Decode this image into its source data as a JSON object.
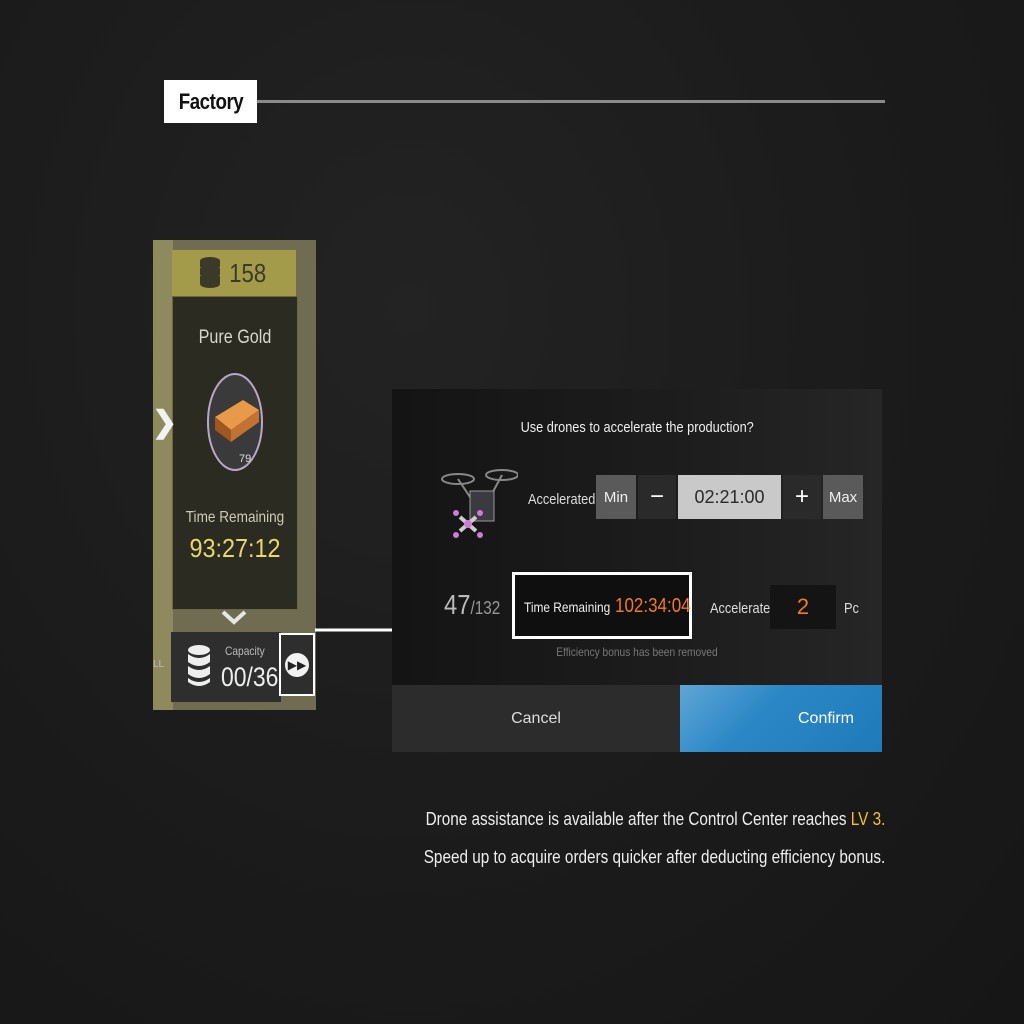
{
  "header": {
    "title": "Factory"
  },
  "factory_card": {
    "stock": "158",
    "item_name": "Pure Gold",
    "item_count": "79",
    "time_remaining_label": "Time Remaining",
    "time_remaining_value": "93:27:12",
    "capacity_label": "Capacity",
    "capacity_value": "00/36",
    "edge_label": "LL"
  },
  "dialog": {
    "question": "Use drones to accelerate the production?",
    "accelerated_label": "Accelerated",
    "min_label": "Min",
    "minus_label": "−",
    "time_value": "02:21:00",
    "plus_label": "+",
    "max_label": "Max",
    "drones_current": "47",
    "drones_total": "/132",
    "time_remaining_label": "Time Remaining",
    "time_remaining_value": "102:34:04",
    "accelerate_label": "Accelerate",
    "accelerate_value": "2",
    "unit_label": "Pc",
    "efficiency_note": "Efficiency bonus has been removed",
    "cancel_label": "Cancel",
    "confirm_label": "Confirm"
  },
  "caption": {
    "line1_prefix": "Drone assistance is available after the Control Center reaches ",
    "line1_highlight": "LV 3",
    "line1_suffix": ".",
    "line2": "Speed up to acquire orders quicker after deducting efficiency bonus."
  },
  "colors": {
    "accent_orange": "#f07a2a",
    "highlight_yellow": "#f2c12e",
    "confirm_blue": "#2b87c6",
    "gold_text": "#e9d86a"
  }
}
